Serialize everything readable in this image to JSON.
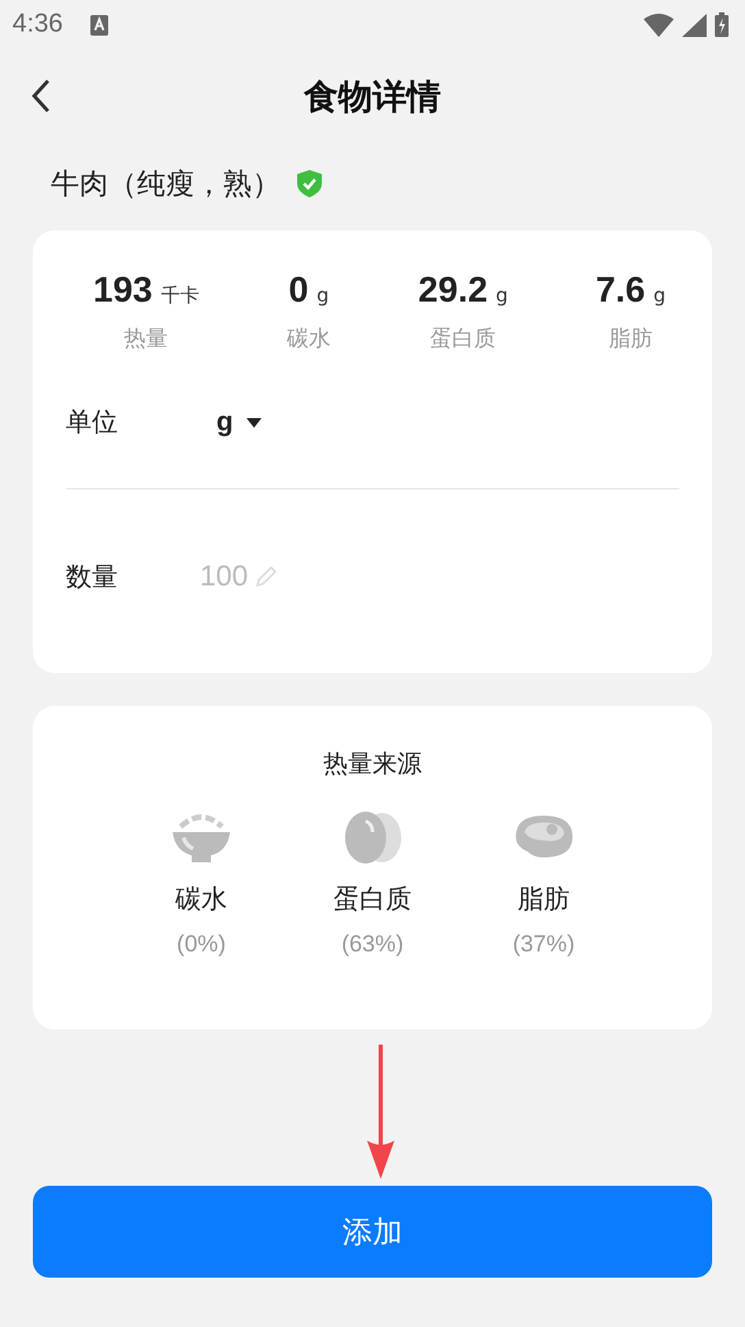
{
  "status_bar": {
    "time": "4:36"
  },
  "header": {
    "title": "食物详情"
  },
  "food": {
    "name": "牛肉（纯瘦，熟）",
    "verified": true
  },
  "nutrients": [
    {
      "value": "193",
      "unit": "千卡",
      "label": "热量"
    },
    {
      "value": "0",
      "unit": "g",
      "label": "碳水"
    },
    {
      "value": "29.2",
      "unit": "g",
      "label": "蛋白质"
    },
    {
      "value": "7.6",
      "unit": "g",
      "label": "脂肪"
    }
  ],
  "unit_field": {
    "label": "单位",
    "value": "g"
  },
  "quantity_field": {
    "label": "数量",
    "placeholder": "100"
  },
  "calorie_sources": {
    "title": "热量来源",
    "items": [
      {
        "kind": "rice",
        "label": "碳水",
        "share": "(0%)"
      },
      {
        "kind": "egg",
        "label": "蛋白质",
        "share": "(63%)"
      },
      {
        "kind": "meat",
        "label": "脂肪",
        "share": "(37%)"
      }
    ]
  },
  "add_button": {
    "label": "添加"
  }
}
